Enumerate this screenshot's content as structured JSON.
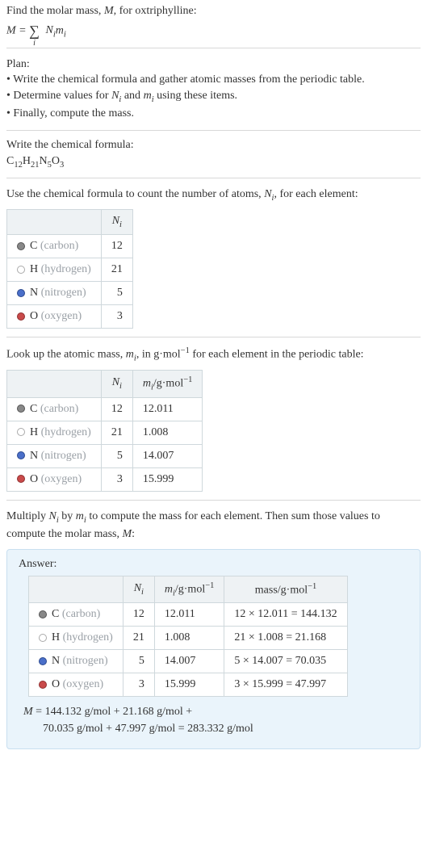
{
  "intro": {
    "line1_pre": "Find the molar mass, ",
    "line1_var": "M",
    "line1_post": ", for oxtriphylline:",
    "formula_lhs": "M",
    "formula_eq": " = ",
    "formula_sum": "∑",
    "formula_sub_i": "i",
    "formula_rhs1": "N",
    "formula_rhs1_sub": "i",
    "formula_rhs2": "m",
    "formula_rhs2_sub": "i"
  },
  "plan": {
    "title": "Plan:",
    "item1": "• Write the chemical formula and gather atomic masses from the periodic table.",
    "item2_pre": "• Determine values for ",
    "item2_var1": "N",
    "item2_sub1": "i",
    "item2_mid": " and ",
    "item2_var2": "m",
    "item2_sub2": "i",
    "item2_post": " using these items.",
    "item3": "• Finally, compute the mass."
  },
  "write_formula": {
    "title": "Write the chemical formula:",
    "c": "C",
    "c_n": "12",
    "h": "H",
    "h_n": "21",
    "n": "N",
    "n_n": "5",
    "o": "O",
    "o_n": "3"
  },
  "count_atoms": {
    "text_pre": "Use the chemical formula to count the number of atoms, ",
    "text_var": "N",
    "text_sub": "i",
    "text_post": ", for each element:",
    "header_N": "N",
    "header_N_sub": "i",
    "rows": [
      {
        "swatch": "gray",
        "el": "C",
        "name": "(carbon)",
        "n": "12"
      },
      {
        "swatch": "white",
        "el": "H",
        "name": "(hydrogen)",
        "n": "21"
      },
      {
        "swatch": "blue",
        "el": "N",
        "name": "(nitrogen)",
        "n": "5"
      },
      {
        "swatch": "red",
        "el": "O",
        "name": "(oxygen)",
        "n": "3"
      }
    ]
  },
  "lookup": {
    "text_pre": "Look up the atomic mass, ",
    "text_var": "m",
    "text_sub": "i",
    "text_mid": ", in g·mol",
    "text_sup": "−1",
    "text_post": " for each element in the periodic table:",
    "header_N": "N",
    "header_N_sub": "i",
    "header_m": "m",
    "header_m_sub": "i",
    "header_unit_pre": "/g·mol",
    "header_unit_sup": "−1",
    "rows": [
      {
        "swatch": "gray",
        "el": "C",
        "name": "(carbon)",
        "n": "12",
        "m": "12.011"
      },
      {
        "swatch": "white",
        "el": "H",
        "name": "(hydrogen)",
        "n": "21",
        "m": "1.008"
      },
      {
        "swatch": "blue",
        "el": "N",
        "name": "(nitrogen)",
        "n": "5",
        "m": "14.007"
      },
      {
        "swatch": "red",
        "el": "O",
        "name": "(oxygen)",
        "n": "3",
        "m": "15.999"
      }
    ]
  },
  "multiply": {
    "text_pre": "Multiply ",
    "var1": "N",
    "sub1": "i",
    "mid1": " by ",
    "var2": "m",
    "sub2": "i",
    "mid2": " to compute the mass for each element. Then sum those values to compute the molar mass, ",
    "var3": "M",
    "post": ":"
  },
  "answer": {
    "title": "Answer:",
    "header_N": "N",
    "header_N_sub": "i",
    "header_m": "m",
    "header_m_sub": "i",
    "header_m_unit_pre": "/g·mol",
    "header_m_unit_sup": "−1",
    "header_mass_pre": "mass/g·mol",
    "header_mass_sup": "−1",
    "rows": [
      {
        "swatch": "gray",
        "el": "C",
        "name": "(carbon)",
        "n": "12",
        "m": "12.011",
        "calc": "12 × 12.011 = 144.132"
      },
      {
        "swatch": "white",
        "el": "H",
        "name": "(hydrogen)",
        "n": "21",
        "m": "1.008",
        "calc": "21 × 1.008 = 21.168"
      },
      {
        "swatch": "blue",
        "el": "N",
        "name": "(nitrogen)",
        "n": "5",
        "m": "14.007",
        "calc": "5 × 14.007 = 70.035"
      },
      {
        "swatch": "red",
        "el": "O",
        "name": "(oxygen)",
        "n": "3",
        "m": "15.999",
        "calc": "3 × 15.999 = 47.997"
      }
    ],
    "final_var": "M",
    "final_line1": " = 144.132 g/mol + 21.168 g/mol + ",
    "final_line2": "70.035 g/mol + 47.997 g/mol = 283.332 g/mol"
  }
}
